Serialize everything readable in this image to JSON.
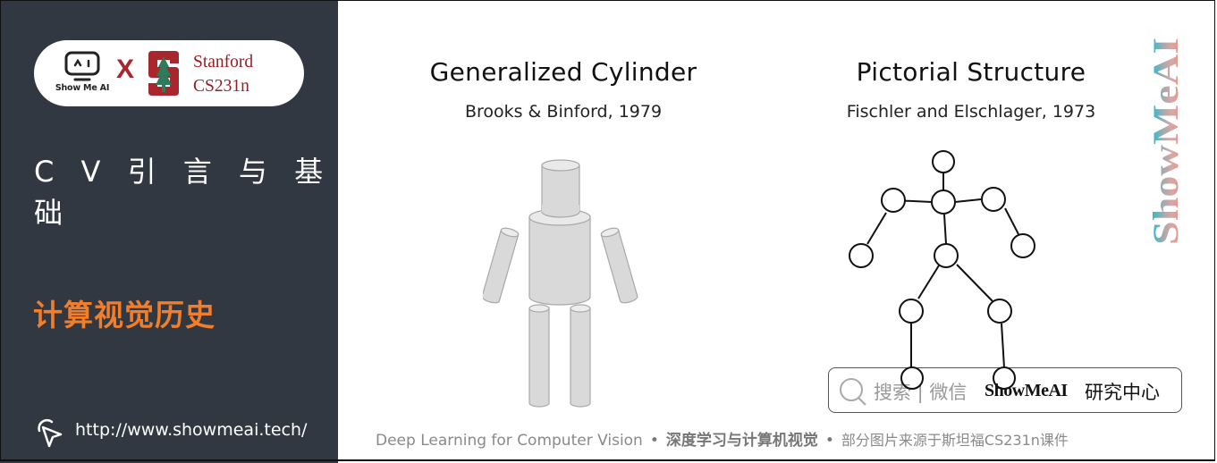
{
  "sidebar": {
    "logo": {
      "showmeai_label": "Show Me AI",
      "cross": "X",
      "stanford_line1": "Stanford",
      "stanford_line2": "CS231n"
    },
    "course_title": "C V 引 言 与 基 础",
    "section_title": "计算视觉历史",
    "url": "http://www.showmeai.tech/"
  },
  "panels": [
    {
      "title": "Generalized Cylinder",
      "subtitle": "Brooks & Binford, 1979",
      "figure": "generalized-cylinder-figure"
    },
    {
      "title": "Pictorial Structure",
      "subtitle": "Fischler and Elschlager, 1973",
      "figure": "pictorial-structure-figure"
    }
  ],
  "brand_vertical": "ShowMeAI",
  "search_box": {
    "icon": "search-icon",
    "hint": "搜索 | 微信",
    "brand": "ShowMeAI",
    "brand_cn": "研究中心"
  },
  "footer": {
    "course_en": "Deep Learning for Computer Vision",
    "separator": "•",
    "course_cn": "深度学习与计算机视觉",
    "source_note": "部分图片来源于斯坦福CS231n课件"
  },
  "colors": {
    "sidebar_bg": "#323841",
    "accent_orange": "#f07e2a",
    "stanford_red": "#9b1d22",
    "cylinder_fill": "#d9d9d9"
  }
}
